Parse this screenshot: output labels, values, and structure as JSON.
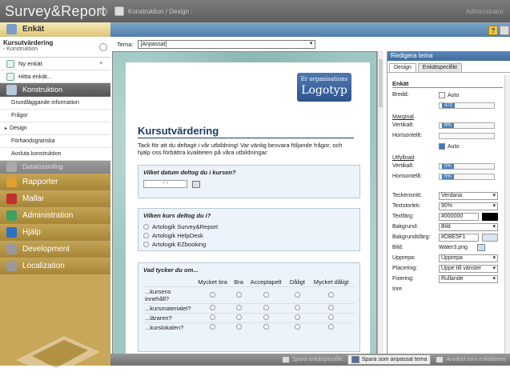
{
  "app": {
    "title": "Survey&Report",
    "breadcrumb": "Konstruktion / Design :",
    "user": "Administrator"
  },
  "help": "?",
  "sidebar": {
    "enkat_label": "Enkät",
    "project": {
      "title": "Kursutvärdering",
      "subtitle": "- Konstruktion"
    },
    "actions": [
      {
        "label": "Ny enkät"
      },
      {
        "label": "Hitta enkät..."
      }
    ],
    "konstruktion_label": "Konstruktion",
    "konstruktion_items": [
      {
        "label": "Grundläggande information"
      },
      {
        "label": "Frågor"
      },
      {
        "label": "Design"
      },
      {
        "label": "Förhandsgranska"
      },
      {
        "label": "Avsluta konstruktion"
      }
    ],
    "datainsamling_label": "Datainsamling",
    "sections": [
      {
        "label": "Rapporter",
        "color": "#e0a030"
      },
      {
        "label": "Mallar",
        "color": "#c03030"
      },
      {
        "label": "Administration",
        "color": "#40a060"
      },
      {
        "label": "Hjälp",
        "color": "#3070c0"
      },
      {
        "label": "Development",
        "color": "#999999"
      },
      {
        "label": "Localization",
        "color": "#999999"
      }
    ]
  },
  "tema": {
    "label": "Tema:",
    "value": "[Anpassat]"
  },
  "survey": {
    "logo_line1": "Er organisations",
    "logo_line2": "Logotyp",
    "title": "Kursutvärdering",
    "intro": "Tack för att du deltagit i vår utbildning! Var vänlig besvara följande frågor, och hjälp oss förbättra kvaliteten på våra utbildningar.",
    "q1": {
      "title": "Vilket datum deltog du i kursen?",
      "date": "-   -"
    },
    "q2": {
      "title": "Vilken kurs deltog du i?",
      "options": [
        "Artologik Survey&Report",
        "Artologik HelpDesk",
        "Artologik EZbooking"
      ]
    },
    "q3": {
      "title": "Vad tycker du om...",
      "cols": [
        "Mycket bra",
        "Bra",
        "Acceptapelt",
        "Dåligt",
        "Mycket dåligt"
      ],
      "rows": [
        "...kursens innehåll?",
        "...kursmaterialet?",
        "...läraren?",
        "...kurslokalen?"
      ]
    }
  },
  "panel": {
    "title": "Redigera tema",
    "tabs": [
      "Design",
      "Enkätspecifikt"
    ],
    "enkat_group": "Enkät",
    "bredd_label": "Bredd:",
    "auto_label": "Auto",
    "bredd_value": "472",
    "marginal_label": "Marginal",
    "vertikalt_label": "Vertikalt:",
    "marginal_v": "6%",
    "horisontellt_label": "Horisontellt:",
    "utfyllnad_label": "Utfyllnad",
    "utfyllnad_v": "5%",
    "utfyllnad_h": "5%",
    "fields": [
      {
        "label": "Teckensnitt:",
        "value": "Verdana",
        "dd": true
      },
      {
        "label": "Textstorlek:",
        "value": "90%",
        "dd": true
      },
      {
        "label": "Textfärg:",
        "value": "#000000",
        "swatch": "#000000"
      },
      {
        "label": "Bakgrund:",
        "value": "Bild",
        "dd": true
      },
      {
        "label": "Bakgrundsfärg:",
        "value": "#DBE5F1",
        "swatch": "#DBE5F1"
      },
      {
        "label": "Bild:",
        "value": "Water3.png"
      },
      {
        "label": "Upprepa:",
        "value": "Upprepa",
        "dd": true
      },
      {
        "label": "Placering:",
        "value": "Uppe till vänster",
        "dd": true
      },
      {
        "label": "Fixering:",
        "value": "Rullande",
        "dd": true
      },
      {
        "label": "Inre",
        "value": ""
      }
    ]
  },
  "bottom": {
    "save_specific": "Spara enkätspecifikt",
    "save_custom": "Spara som anpassat tema",
    "use_as": "Använd som enkättema"
  }
}
